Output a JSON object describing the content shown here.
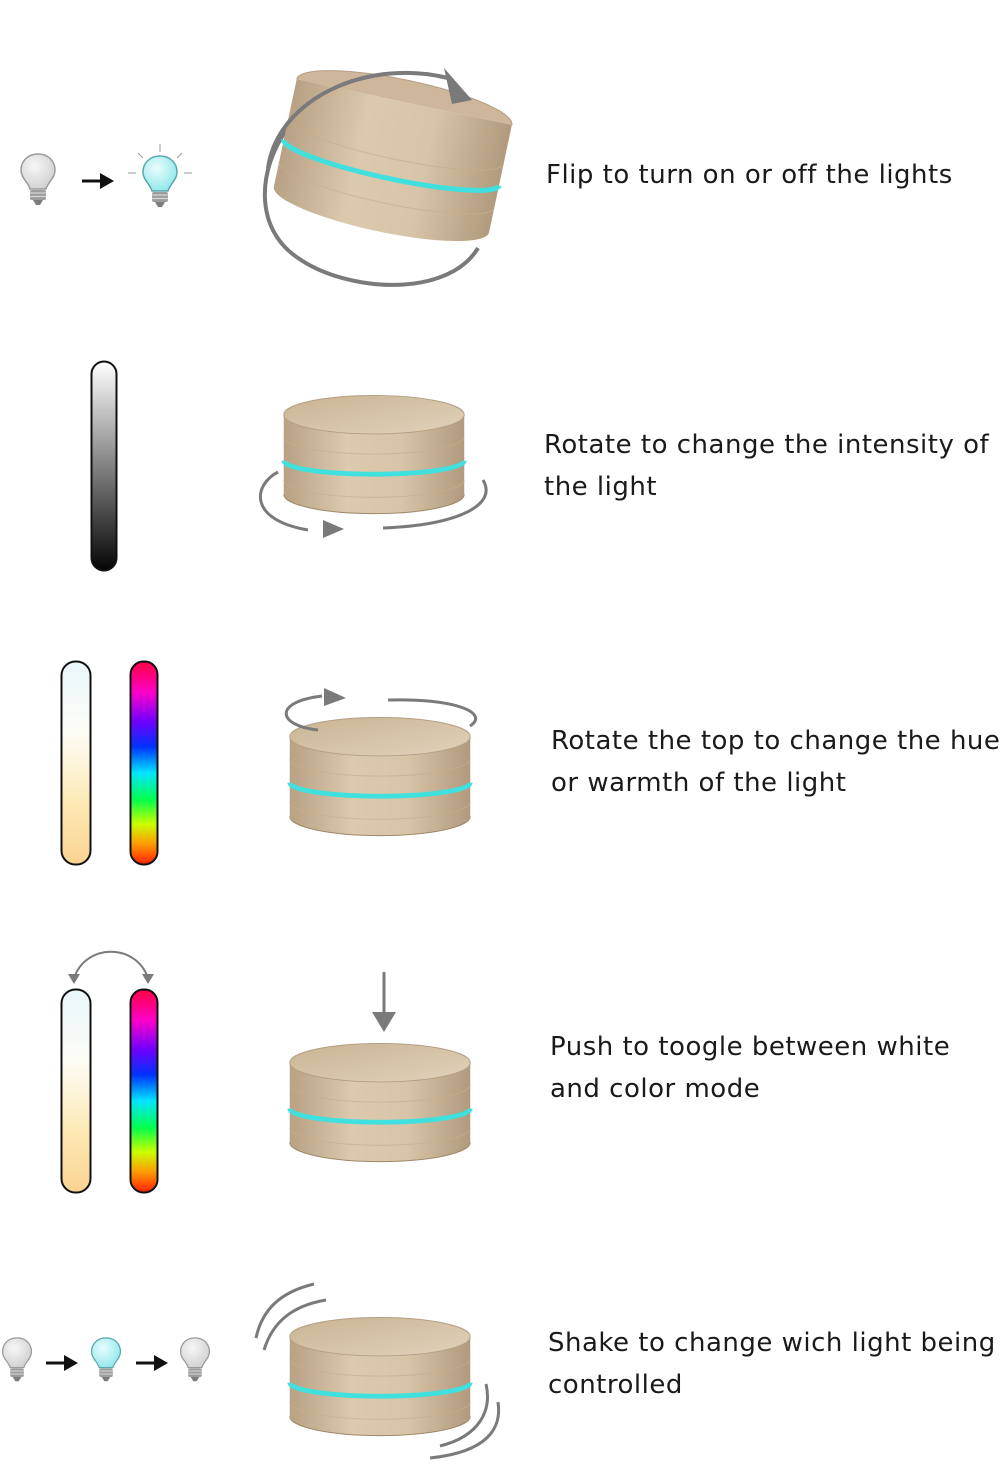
{
  "steps": [
    {
      "id": "flip",
      "caption_lines": [
        "Flip to turn on or off the lights"
      ]
    },
    {
      "id": "rotate-intensity",
      "caption_lines": [
        "Rotate to change the intensity of",
        "the light"
      ]
    },
    {
      "id": "rotate-top",
      "caption_lines": [
        "Rotate the top to change the hue",
        "or warmth of the light"
      ]
    },
    {
      "id": "push",
      "caption_lines": [
        "Push to toogle between white",
        "and color mode"
      ]
    },
    {
      "id": "shake",
      "caption_lines": [
        "Shake to change wich light being",
        "controlled"
      ]
    }
  ],
  "colors": {
    "bulb_off": "#dcdcdc",
    "bulb_on": "#bff3f5",
    "led_ring": "#3fe0de",
    "wood_light": "#dcc9ae",
    "wood_dark": "#b59e82",
    "arrow": "#7a7a7a"
  },
  "icons": [
    "bulb-off-icon",
    "bulb-on-icon",
    "arrow-right-icon",
    "flip-arrow-icon",
    "rotate-arrow-icon",
    "push-arrow-icon",
    "shake-lines-icon",
    "swap-arrow-icon"
  ]
}
